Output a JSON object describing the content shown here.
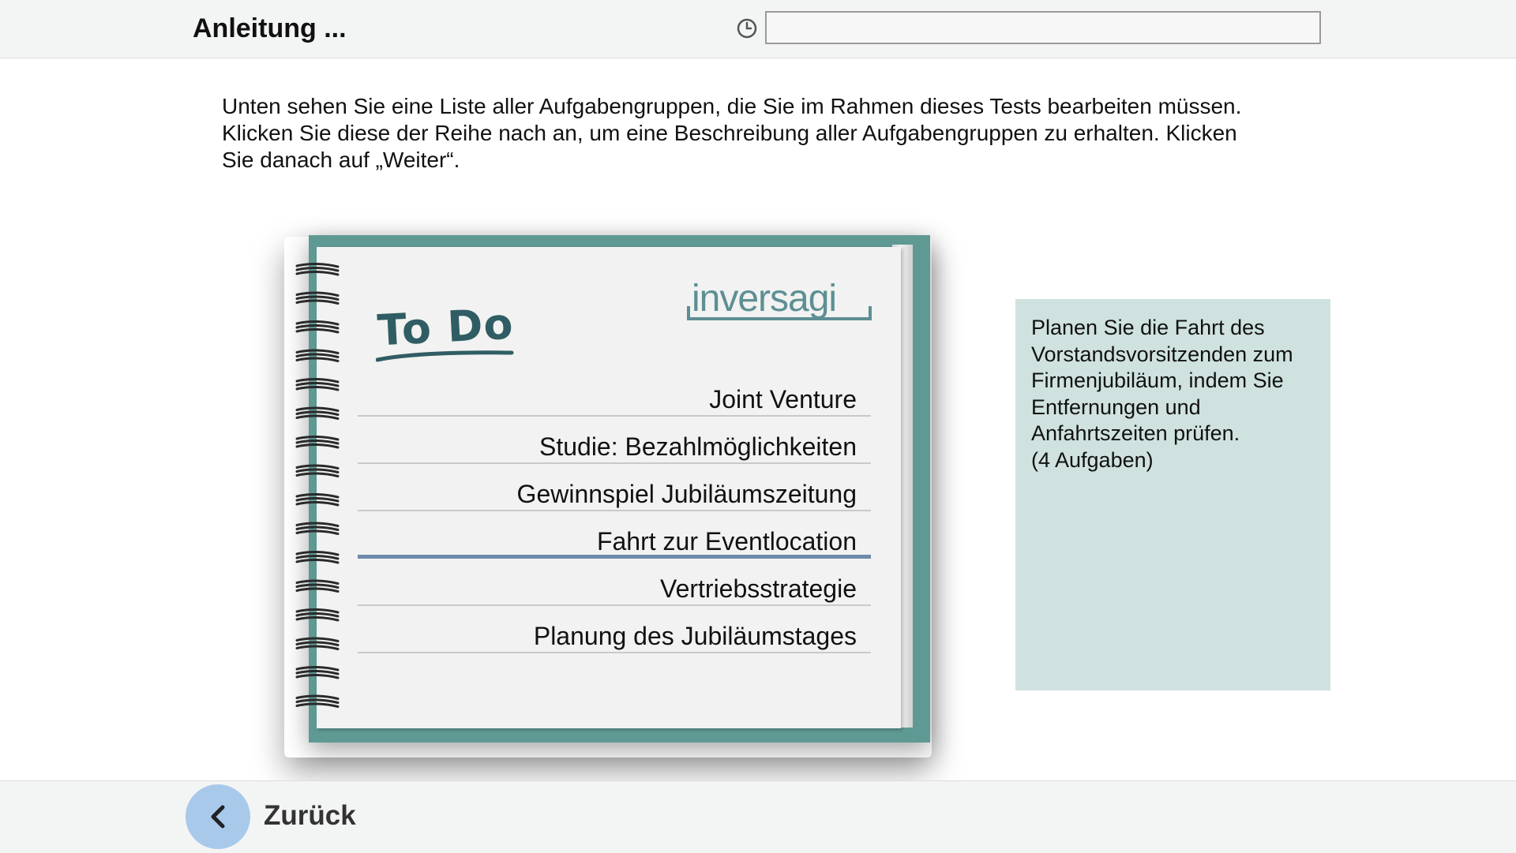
{
  "header": {
    "title": "Anleitung ...",
    "timer_icon": "clock-icon"
  },
  "instructions": {
    "line1": "Unten sehen Sie eine Liste aller Aufgabengruppen, die Sie im Rahmen dieses Tests bearbeiten müssen.",
    "line2": "Klicken Sie diese der Reihe nach an, um eine Beschreibung aller Aufgabengruppen zu erhalten. Klicken",
    "line3": "Sie danach auf „Weiter“."
  },
  "notebook": {
    "heading": "To Do",
    "logo": "inversagi",
    "tasks": [
      {
        "label": "Joint Venture"
      },
      {
        "label": "Studie: Bezahlmöglichkeiten"
      },
      {
        "label": "Gewinnspiel Jubiläumszeitung"
      },
      {
        "label": "Fahrt zur Eventlocation",
        "selected": true
      },
      {
        "label": "Vertriebsstrategie"
      },
      {
        "label": "Planung des Jubiläumstages"
      }
    ],
    "cover_color": "#5e9a93",
    "selected_underline_color": "#6f8bab"
  },
  "description": {
    "lines": [
      "Planen Sie die Fahrt des",
      "Vorstandsvorsitzenden zum",
      "Firmenjubiläum, indem Sie",
      "Entfernungen und",
      "Anfahrtszeiten prüfen.",
      "(4 Aufgaben)"
    ],
    "background": "#cfe2df"
  },
  "footer": {
    "back_label": "Zurück",
    "back_icon": "chevron-left-icon",
    "back_button_color": "#a8c9ea"
  }
}
